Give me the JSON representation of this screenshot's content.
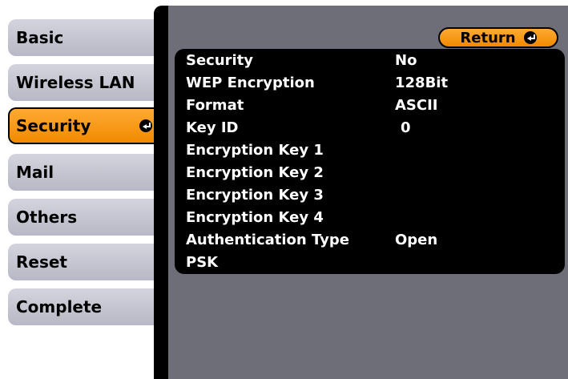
{
  "sidebar": {
    "items": [
      {
        "label": "Basic"
      },
      {
        "label": "Wireless LAN"
      },
      {
        "label": "Security"
      },
      {
        "label": "Mail"
      },
      {
        "label": "Others"
      },
      {
        "label": "Reset"
      },
      {
        "label": "Complete"
      }
    ],
    "active": "Security"
  },
  "return_button": {
    "label": "Return"
  },
  "settings": [
    {
      "label": "Security",
      "value": "No"
    },
    {
      "label": "WEP Encryption",
      "value": "128Bit"
    },
    {
      "label": "Format",
      "value": "ASCII"
    },
    {
      "label": "Key ID",
      "value": "0"
    },
    {
      "label": "Encryption Key 1",
      "value": ""
    },
    {
      "label": "Encryption Key 2",
      "value": ""
    },
    {
      "label": "Encryption Key 3",
      "value": ""
    },
    {
      "label": "Encryption Key 4",
      "value": ""
    },
    {
      "label": "Authentication Type",
      "value": "Open"
    },
    {
      "label": "PSK",
      "value": ""
    }
  ],
  "colors": {
    "accent_orange": "#f5940f",
    "tab_gray": "#c8c8d4",
    "panel_gray": "#6e6e78",
    "list_bg": "#000000"
  }
}
